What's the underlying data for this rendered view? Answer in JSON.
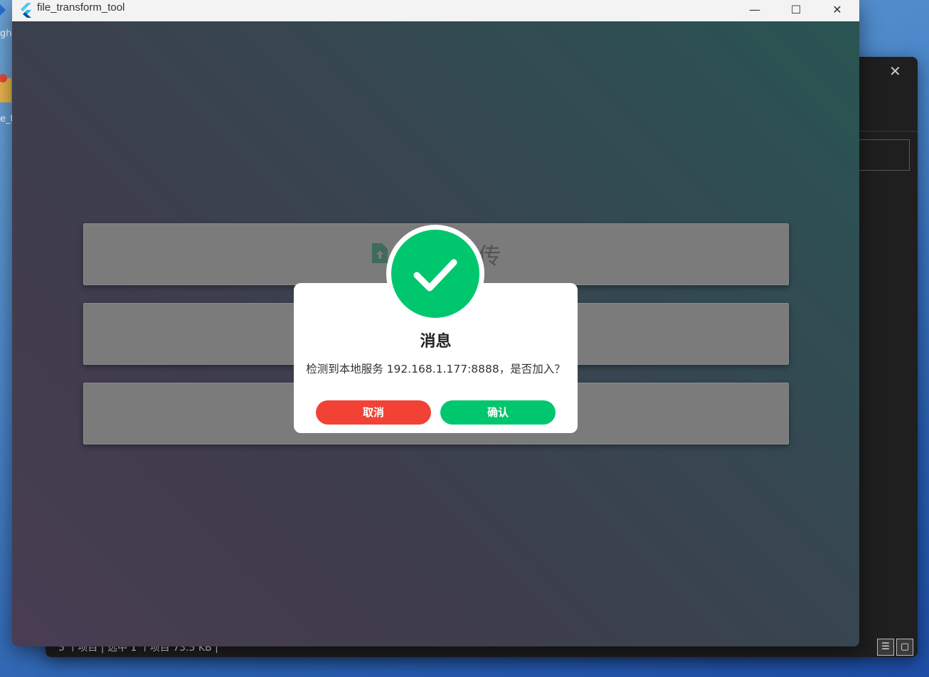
{
  "desktop": {
    "icon1_text": "gh",
    "icon2_text": "e_t"
  },
  "background_window": {
    "status_text": "5 个项目  |  选中 1 个项目  73.5 KB  |"
  },
  "app": {
    "title": "file_transform_tool",
    "cards": [
      {
        "label": "传"
      },
      {
        "label": ""
      },
      {
        "label": ""
      }
    ]
  },
  "dialog": {
    "title": "消息",
    "message": "检测到本地服务 192.168.1.177:8888，是否加入？",
    "cancel_label": "取消",
    "confirm_label": "确认",
    "colors": {
      "success": "#00c76e",
      "cancel": "#f24236",
      "confirm": "#00c76e"
    }
  }
}
